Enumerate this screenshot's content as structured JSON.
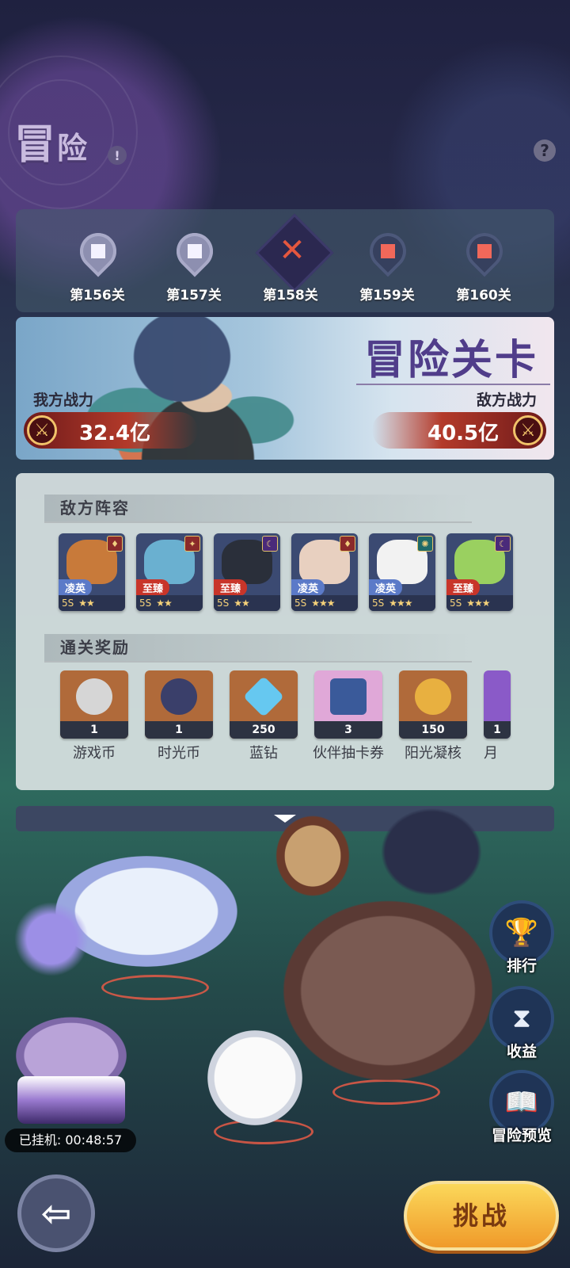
{
  "header": {
    "title_part1": "冒",
    "title_part2": "险",
    "info_icon": "!",
    "help_icon": "?"
  },
  "stages": [
    {
      "label": "第156关",
      "state": "cleared"
    },
    {
      "label": "第157关",
      "state": "cleared"
    },
    {
      "label": "第158关",
      "state": "current"
    },
    {
      "label": "第159关",
      "state": "locked"
    },
    {
      "label": "第160关",
      "state": "locked"
    }
  ],
  "banner": {
    "title": "冒险关卡",
    "my_power_label": "我方战力",
    "my_power_value": "32.4亿",
    "enemy_power_label": "敌方战力",
    "enemy_power_value": "40.5亿"
  },
  "enemy_section": {
    "title": "敌方阵容",
    "heroes": [
      {
        "tier": "凌英",
        "level": "5S",
        "stars": "★★",
        "tier_color": "#5b7ac8",
        "face": "#c87a3a"
      },
      {
        "tier": "至臻",
        "level": "5S",
        "stars": "★★",
        "tier_color": "#c8352a",
        "face": "#6ab0d0"
      },
      {
        "tier": "至臻",
        "level": "5S",
        "stars": "★★",
        "tier_color": "#c8352a",
        "face": "#2a2f3a"
      },
      {
        "tier": "凌英",
        "level": "5S",
        "stars": "★★★",
        "tier_color": "#5b7ac8",
        "face": "#e8d0c0"
      },
      {
        "tier": "凌英",
        "level": "5S",
        "stars": "★★★",
        "tier_color": "#5b7ac8",
        "face": "#f2f2f2"
      },
      {
        "tier": "至臻",
        "level": "5S",
        "stars": "★★★",
        "tier_color": "#c8352a",
        "face": "#9ad060"
      }
    ]
  },
  "reward_section": {
    "title": "通关奖励",
    "items": [
      {
        "name": "游戏币",
        "count": "1",
        "bg": "#b06a3a",
        "icon": "#d6d6d6"
      },
      {
        "name": "时光币",
        "count": "1",
        "bg": "#b06a3a",
        "icon": "#3a3f6a"
      },
      {
        "name": "蓝钻",
        "count": "250",
        "bg": "#b06a3a",
        "icon": "#66c8f0"
      },
      {
        "name": "伙伴抽卡券",
        "count": "3",
        "bg": "#e0a8d8",
        "icon": "#3a5a9a"
      },
      {
        "name": "阳光凝核",
        "count": "150",
        "bg": "#b06a3a",
        "icon": "#e8b040"
      },
      {
        "name": "月",
        "count": "1",
        "bg": "#8a5ac8",
        "icon": "#d8d0f0"
      }
    ]
  },
  "side_buttons": [
    {
      "label": "排行",
      "icon": "trophy-icon",
      "glyph": "🏆"
    },
    {
      "label": "收益",
      "icon": "hourglass-icon",
      "glyph": "⧗"
    },
    {
      "label": "冒险预览",
      "icon": "book-icon",
      "glyph": "📖"
    }
  ],
  "afk": {
    "label": "已挂机:",
    "time": "00:48:57"
  },
  "buttons": {
    "back_icon": "⇦",
    "challenge": "挑战"
  },
  "colors": {
    "accent_title": "#503d8a",
    "challenge_button": "#f5b942",
    "power_bar": "#b33a2a"
  }
}
